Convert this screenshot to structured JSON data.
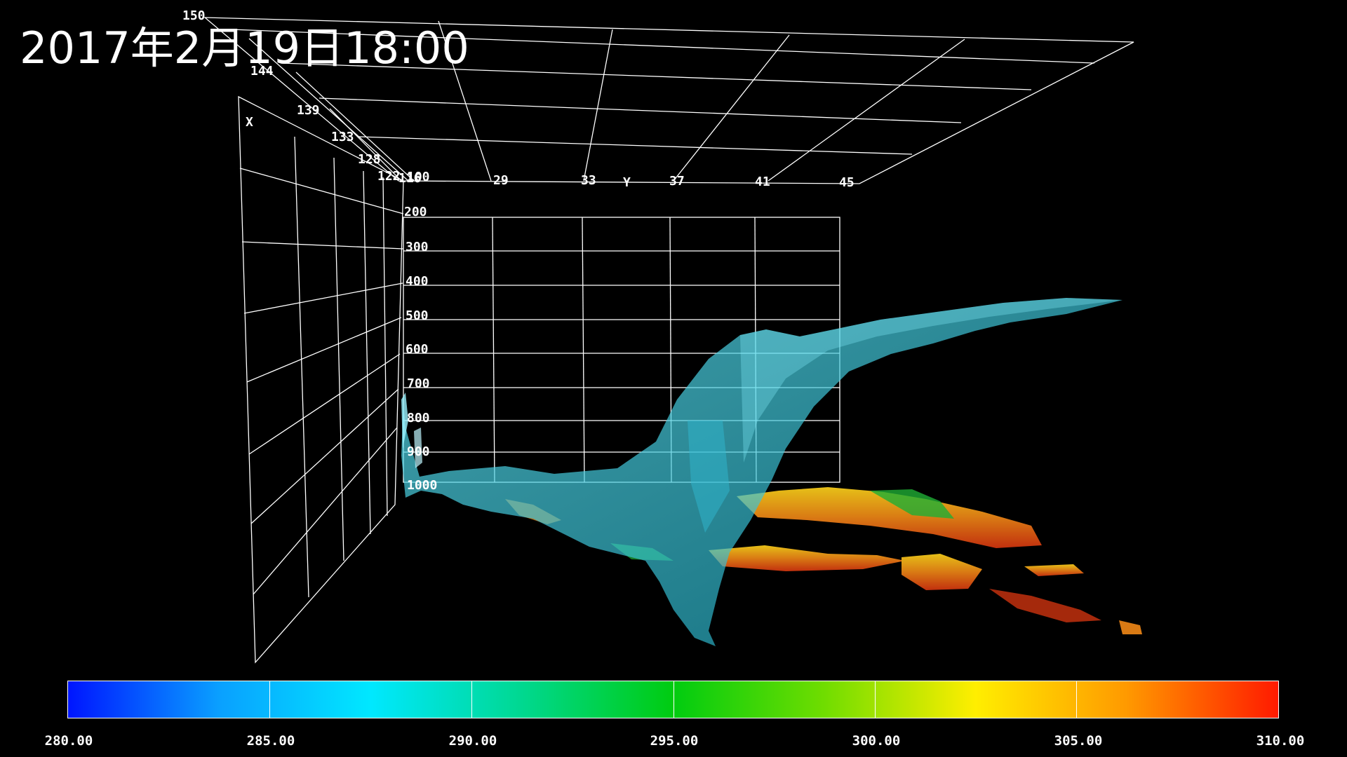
{
  "timestamp": "2017年2月19日18:00",
  "axes": {
    "x_label": "X",
    "y_label": "Y",
    "x_ticks": [
      "150",
      "144",
      "139",
      "133",
      "128",
      "122",
      "116"
    ],
    "y_ticks": [
      "29",
      "33",
      "37",
      "41",
      "45"
    ],
    "z_ticks": [
      "100",
      "200",
      "300",
      "400",
      "500",
      "600",
      "700",
      "800",
      "900",
      "1000"
    ]
  },
  "colorbar": {
    "labels": [
      "280.00",
      "285.00",
      "290.00",
      "295.00",
      "300.00",
      "305.00",
      "310.00"
    ],
    "colors": [
      "#0015ff",
      "#0aa0ff",
      "#00e8ff",
      "#00d890",
      "#00cc10",
      "#70dd00",
      "#ffee00",
      "#ff9900",
      "#ff1a00"
    ]
  },
  "colors": {
    "background": "#000000",
    "grid": "#ffffff",
    "isosurface": "#3fd2e8",
    "terrain_low": "#1fae35",
    "terrain_mid": "#e6c018",
    "terrain_high": "#d23a10"
  }
}
